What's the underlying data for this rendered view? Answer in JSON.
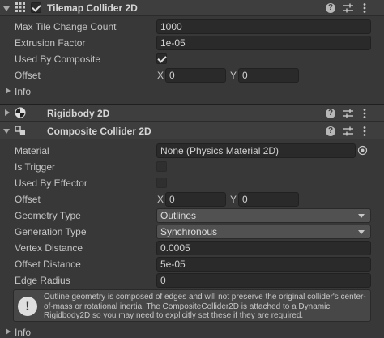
{
  "tilemap_collider": {
    "title": "Tilemap Collider 2D",
    "enabled": true,
    "fields": {
      "max_tile_change_count": {
        "label": "Max Tile Change Count",
        "value": "1000"
      },
      "extrusion_factor": {
        "label": "Extrusion Factor",
        "value": "1e-05"
      },
      "used_by_composite": {
        "label": "Used By Composite",
        "checked": true
      },
      "offset": {
        "label": "Offset",
        "x_label": "X",
        "x": "0",
        "y_label": "Y",
        "y": "0"
      }
    },
    "info_label": "Info"
  },
  "rigidbody": {
    "title": "Rigidbody 2D"
  },
  "composite_collider": {
    "title": "Composite Collider 2D",
    "fields": {
      "material": {
        "label": "Material",
        "value": "None (Physics Material 2D)"
      },
      "is_trigger": {
        "label": "Is Trigger",
        "checked": false
      },
      "used_by_effector": {
        "label": "Used By Effector",
        "checked": false
      },
      "offset": {
        "label": "Offset",
        "x_label": "X",
        "x": "0",
        "y_label": "Y",
        "y": "0"
      },
      "geometry_type": {
        "label": "Geometry Type",
        "value": "Outlines"
      },
      "generation_type": {
        "label": "Generation Type",
        "value": "Synchronous"
      },
      "vertex_distance": {
        "label": "Vertex Distance",
        "value": "0.0005"
      },
      "offset_distance": {
        "label": "Offset Distance",
        "value": "5e-05"
      },
      "edge_radius": {
        "label": "Edge Radius",
        "value": "0"
      }
    },
    "help_text": "Outline geometry is composed of edges and will not preserve the original collider's center-of-mass or rotational inertia.  The CompositeCollider2D is attached to a Dynamic Rigidbody2D so you may need to explicitly set these if they are required.",
    "info_label": "Info"
  },
  "icons": {
    "tilemap": "grid-icon",
    "rigidbody": "rigidbody-icon",
    "composite": "composite-collider-icon",
    "help": "help-icon",
    "presets": "sliders-icon",
    "menu": "kebab-menu-icon",
    "object_picker": "object-picker-icon",
    "info": "info-icon"
  }
}
